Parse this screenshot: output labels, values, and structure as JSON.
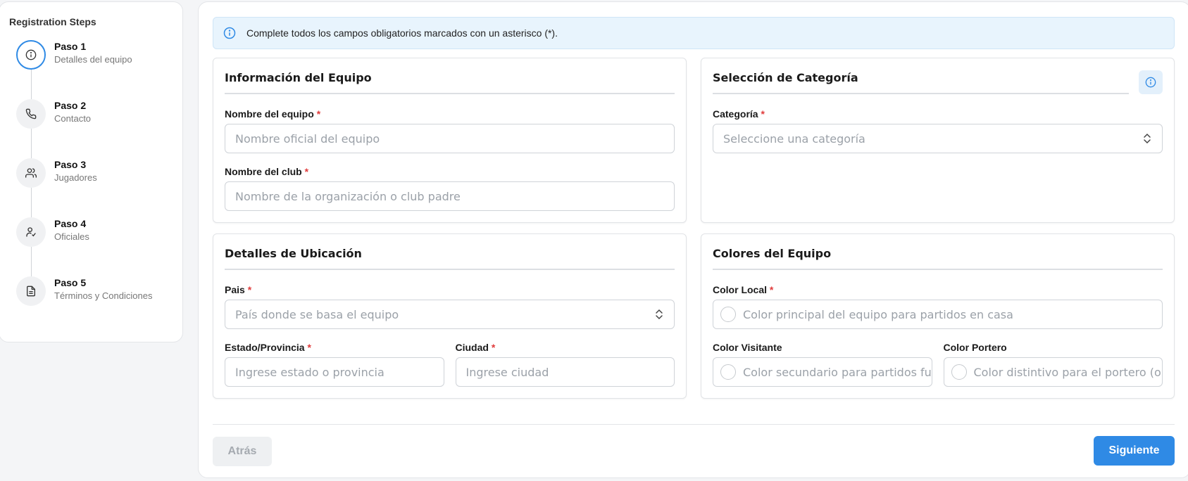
{
  "sidebar": {
    "title": "Registration Steps",
    "steps": [
      {
        "title": "Paso 1",
        "subtitle": "Detalles del equipo",
        "icon": "info-icon",
        "active": true
      },
      {
        "title": "Paso 2",
        "subtitle": "Contacto",
        "icon": "phone-icon",
        "active": false
      },
      {
        "title": "Paso 3",
        "subtitle": "Jugadores",
        "icon": "users-icon",
        "active": false
      },
      {
        "title": "Paso 4",
        "subtitle": "Oficiales",
        "icon": "user-check-icon",
        "active": false
      },
      {
        "title": "Paso 5",
        "subtitle": "Términos y Condiciones",
        "icon": "document-icon",
        "active": false
      }
    ]
  },
  "banner": {
    "text": "Complete todos los campos obligatorios marcados con un asterisco (*)."
  },
  "team_info": {
    "title": "Información del Equipo",
    "team_name_label": "Nombre del equipo",
    "team_name_placeholder": "Nombre oficial del equipo",
    "club_name_label": "Nombre del club",
    "club_name_placeholder": "Nombre de la organización o club padre"
  },
  "category": {
    "title": "Selección de Categoría",
    "label": "Categoría",
    "placeholder": "Seleccione una categoría"
  },
  "location": {
    "title": "Detalles de Ubicación",
    "country_label": "Pais",
    "country_placeholder": "País donde se basa el equipo",
    "state_label": "Estado/Provincia",
    "state_placeholder": "Ingrese estado o provincia",
    "city_label": "Ciudad",
    "city_placeholder": "Ingrese ciudad"
  },
  "colors": {
    "title": "Colores del Equipo",
    "home_label": "Color Local",
    "home_placeholder": "Color principal del equipo para partidos en casa",
    "away_label": "Color Visitante",
    "away_placeholder": "Color secundario para partidos fuera",
    "keeper_label": "Color Portero",
    "keeper_placeholder": "Color distintivo para el portero (opcional)"
  },
  "required_mark": "*",
  "footer": {
    "back_label": "Atrás",
    "next_label": "Siguiente"
  },
  "theme": {
    "accent": "#2f8ae5",
    "required": "#e03c3c",
    "banner_bg": "#e8f4fd"
  }
}
